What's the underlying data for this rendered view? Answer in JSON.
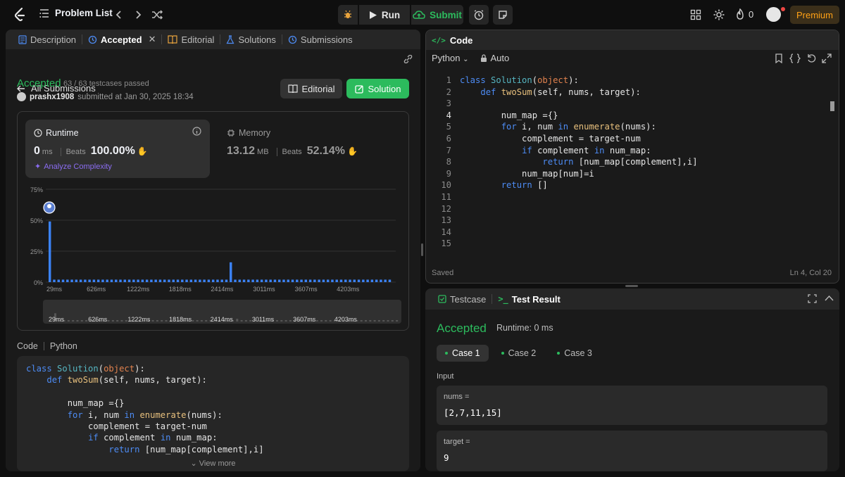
{
  "topbar": {
    "problem_list": "Problem List",
    "run": "Run",
    "submit": "Submit",
    "streak": "0",
    "premium": "Premium"
  },
  "left_tabs": [
    {
      "label": "Description"
    },
    {
      "label": "Accepted"
    },
    {
      "label": "Editorial"
    },
    {
      "label": "Solutions"
    },
    {
      "label": "Submissions"
    }
  ],
  "submission": {
    "back": "All Submissions",
    "status": "Accepted",
    "testcases": "63 / 63 testcases passed",
    "user": "prashx1908",
    "submitted": "submitted at Jan 30, 2025 18:34",
    "editorial_btn": "Editorial",
    "solution_btn": "Solution"
  },
  "runtime": {
    "label": "Runtime",
    "value": "0",
    "unit": "ms",
    "beats_label": "Beats",
    "beats": "100.00%",
    "analyze": "Analyze Complexity"
  },
  "memory": {
    "label": "Memory",
    "value": "13.12",
    "unit": "MB",
    "beats_label": "Beats",
    "beats": "52.14%"
  },
  "chart_data": {
    "type": "bar",
    "yticks": [
      "75%",
      "50%",
      "25%",
      "0%"
    ],
    "ylim": [
      0,
      75
    ],
    "xticks": [
      "29ms",
      "626ms",
      "1222ms",
      "1818ms",
      "2414ms",
      "3011ms",
      "3607ms",
      "4203ms"
    ],
    "values": [
      49,
      2,
      2,
      2,
      2,
      2,
      2,
      2,
      2,
      2,
      2,
      2,
      2,
      2,
      2,
      2,
      2,
      2,
      2,
      2,
      2,
      2,
      2,
      2,
      2,
      2,
      2,
      2,
      2,
      2,
      2,
      2,
      2,
      2,
      2,
      2,
      2,
      2,
      2,
      2,
      2,
      2,
      2,
      2,
      2,
      2,
      2,
      2,
      2,
      2,
      2,
      2,
      2,
      2,
      2,
      2,
      2,
      2,
      2,
      2,
      2,
      2,
      2,
      2,
      2,
      2,
      2,
      2,
      2,
      2,
      2,
      2,
      2,
      2,
      2,
      2,
      2,
      2
    ],
    "spike_index": 41,
    "spike_value": 16,
    "accent": "#3b82f6"
  },
  "code_section": {
    "label": "Code",
    "lang": "Python",
    "view_more": "View more"
  },
  "code_lines": [
    "class Solution(object):",
    "    def twoSum(self, nums, target):",
    "",
    "        num_map ={}",
    "        for i, num in enumerate(nums):",
    "            complement = target-num",
    "            if complement in num_map:",
    "                return [num_map[complement],i]",
    "            num_map[num]=i",
    "        return []",
    "",
    "",
    "",
    "",
    ""
  ],
  "editor": {
    "title": "Code",
    "lang": "Python",
    "mode": "Auto",
    "saved": "Saved",
    "cursor": "Ln 4, Col 20"
  },
  "test": {
    "tab1": "Testcase",
    "tab2": "Test Result",
    "status": "Accepted",
    "runtime": "Runtime: 0 ms",
    "cases": [
      "Case 1",
      "Case 2",
      "Case 3"
    ],
    "input_label": "Input",
    "nums_name": "nums =",
    "nums_value": "[2,7,11,15]",
    "target_name": "target =",
    "target_value": "9"
  }
}
